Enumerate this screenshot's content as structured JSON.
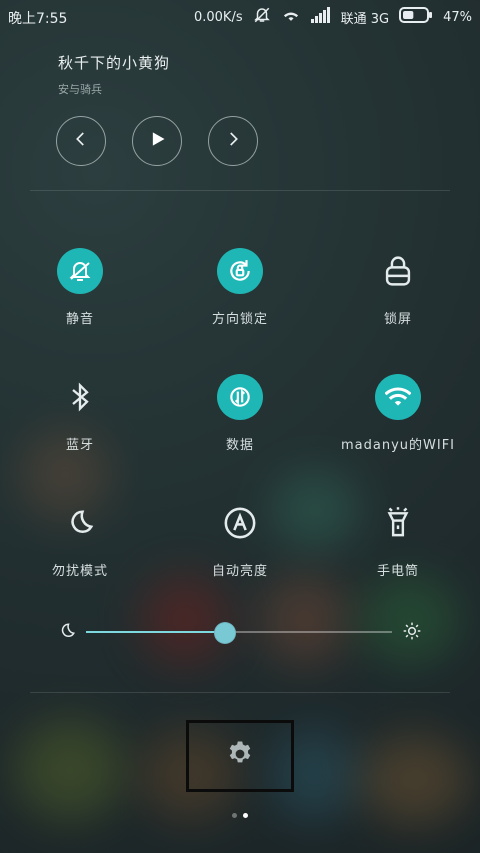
{
  "status_bar": {
    "time": "晚上7:55",
    "speed": "0.00K/s",
    "carrier": "联通 3G",
    "battery": "47%",
    "battery_level": 0.47,
    "icons": [
      "mute-notification-icon",
      "wifi-icon",
      "signal-icon",
      "battery-icon"
    ]
  },
  "media": {
    "title": "秋千下的小黄狗",
    "artist": "安与骑兵",
    "controls": [
      "previous-icon",
      "play-icon",
      "next-icon"
    ]
  },
  "toggles": [
    {
      "label": "静音",
      "icon": "mute-icon",
      "active": true
    },
    {
      "label": "方向锁定",
      "icon": "rotation-lock-icon",
      "active": true
    },
    {
      "label": "锁屏",
      "icon": "lock-icon",
      "active": false
    },
    {
      "label": "蓝牙",
      "icon": "bluetooth-icon",
      "active": false
    },
    {
      "label": "数据",
      "icon": "data-icon",
      "active": true
    },
    {
      "label": "madanyu的WIFI",
      "icon": "wifi-icon",
      "active": true
    },
    {
      "label": "勿扰模式",
      "icon": "moon-icon",
      "active": false
    },
    {
      "label": "自动亮度",
      "icon": "auto-brightness-icon",
      "active": false
    },
    {
      "label": "手电筒",
      "icon": "flashlight-icon",
      "active": false
    }
  ],
  "brightness": {
    "level": 0.45,
    "low_icon": "moon-small-icon",
    "high_icon": "sun-icon"
  },
  "settings": {
    "icon": "gear-icon"
  },
  "page_indicator": {
    "current": 2,
    "total": 2
  },
  "colors": {
    "accent": "#1fb7b5",
    "slider_fill": "#7ed9df",
    "slider_thumb": "#79c9d5",
    "bg": "#243334"
  }
}
